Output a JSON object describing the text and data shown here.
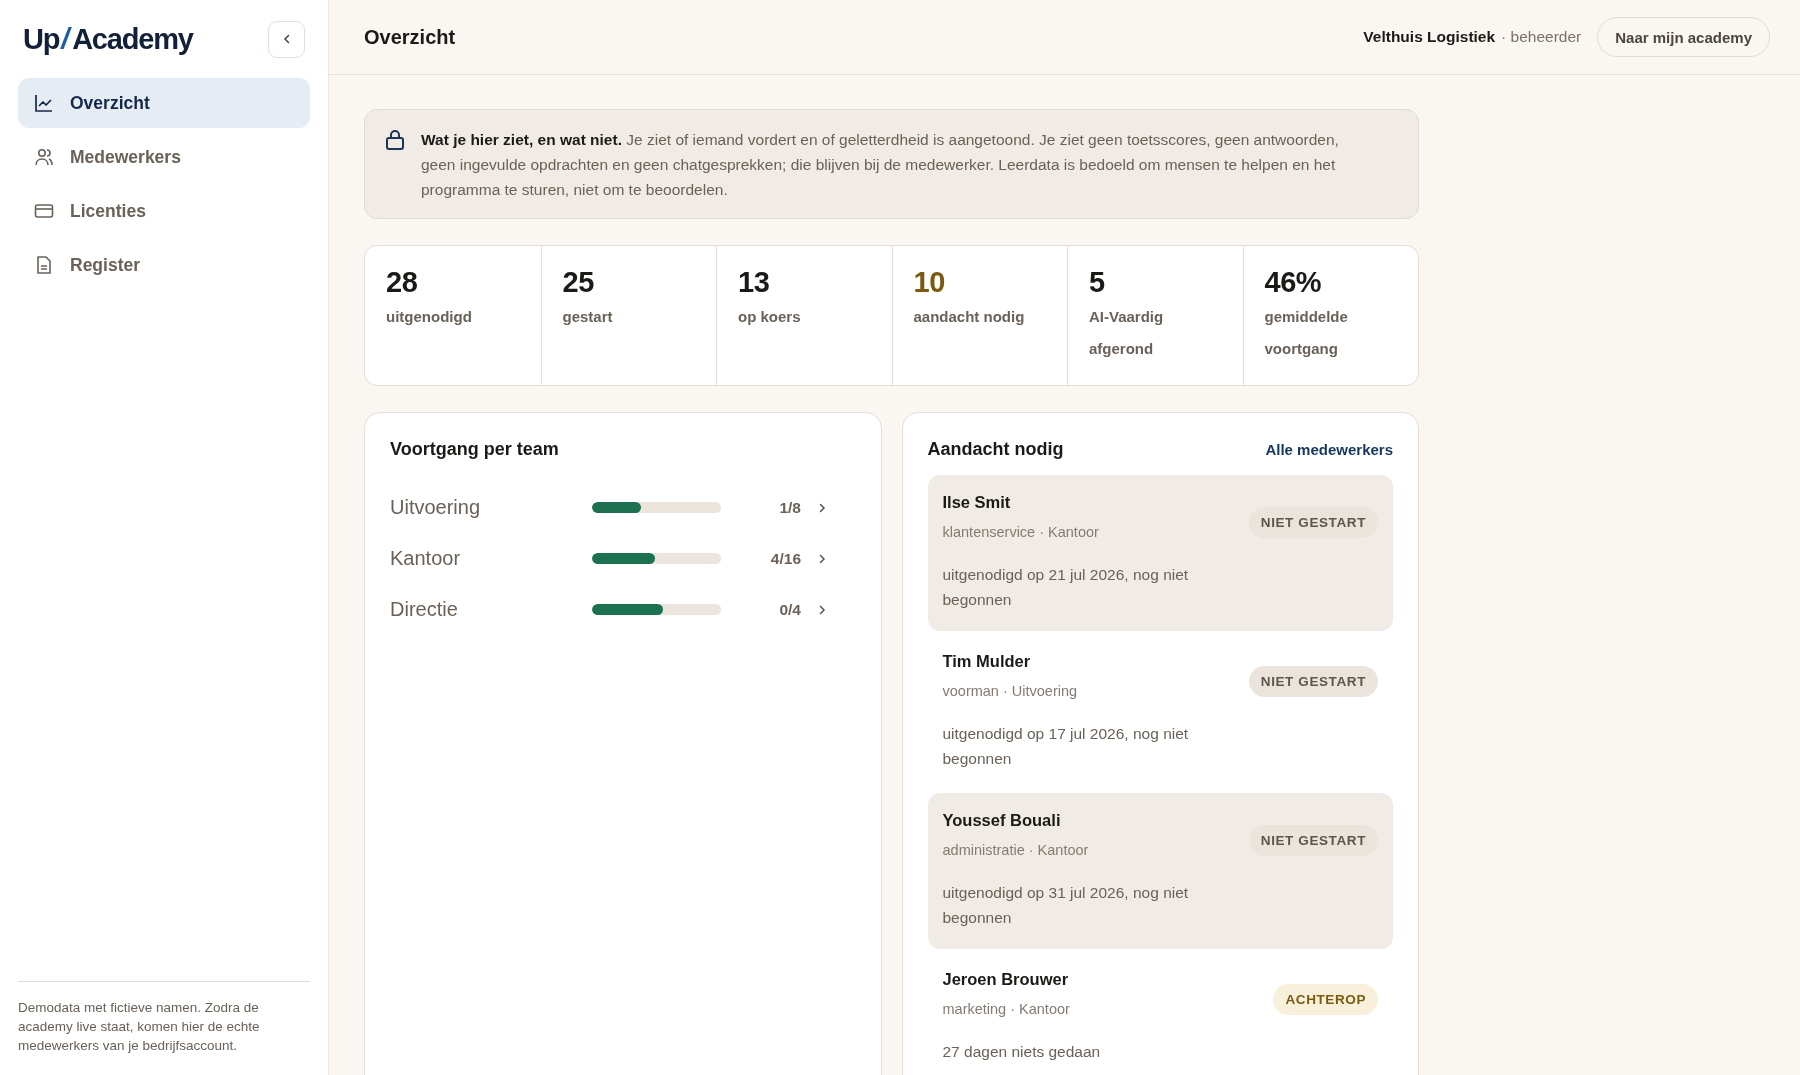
{
  "logo": {
    "first": "Up",
    "slash": "/",
    "second": "Academy"
  },
  "sidebar": {
    "items": [
      {
        "label": "Overzicht",
        "kind": "chart",
        "selected": true
      },
      {
        "label": "Medewerkers",
        "kind": "users",
        "selected": false
      },
      {
        "label": "Licenties",
        "kind": "card",
        "selected": false
      },
      {
        "label": "Register",
        "kind": "document",
        "selected": false
      }
    ],
    "footer": "Demodata met fictieve namen. Zodra de academy live staat, komen hier de echte medewerkers van je bedrijfsaccount."
  },
  "header": {
    "title": "Overzicht",
    "company": "Velthuis Logistiek",
    "role": "· beheerder",
    "button": "Naar mijn academy"
  },
  "notice": {
    "lead": "**Wat je hier ziet, en wat niet.** Je ziet of iemand vordert en of geletterdheid is aangetoond. Je ziet geen toetsscores, geen antwoorden, geen ingevulde opdrachten en geen chatgesprekken; die blijven bij de medewerker. Leerdata is bedoeld om mensen te helpen en het programma te sturen, niet om te beoordelen."
  },
  "stats": [
    {
      "value": "28",
      "label": "uitgenodigd",
      "kind": "normal"
    },
    {
      "value": "25",
      "label": "gestart",
      "kind": "normal"
    },
    {
      "value": "13",
      "label": "op koers",
      "kind": "normal"
    },
    {
      "value": "10",
      "label": "aandacht nodig",
      "kind": "attention"
    },
    {
      "value": "5",
      "label": "AI-Vaardig afgerond",
      "kind": "normal"
    },
    {
      "value": "46%",
      "label": "gemiddelde voortgang",
      "kind": "normal"
    }
  ],
  "teams": {
    "title": "Voortgang per team",
    "rows": [
      {
        "name": "Uitvoering",
        "level": 0.38,
        "count": "1/8"
      },
      {
        "name": "Kantoor",
        "level": 0.49,
        "count": "4/16"
      },
      {
        "name": "Directie",
        "level": 0.55,
        "count": "0/4"
      }
    ]
  },
  "attention": {
    "title": "Aandacht nodig",
    "link": "Alle medewerkers",
    "people": [
      {
        "name": "Ilse Smit",
        "meta": "klantenservice · Kantoor",
        "note": "uitgenodigd op 21 jul 2026, nog niet begonnen",
        "badge": "NIET GESTART",
        "kind": "not-started",
        "highlighted": true
      },
      {
        "name": "Tim Mulder",
        "meta": "voorman · Uitvoering",
        "note": "uitgenodigd op 17 jul 2026, nog niet begonnen",
        "badge": "NIET GESTART",
        "kind": "not-started",
        "highlighted": false
      },
      {
        "name": "Youssef Bouali",
        "meta": "administratie · Kantoor",
        "note": "uitgenodigd op 31 jul 2026, nog niet begonnen",
        "badge": "NIET GESTART",
        "kind": "not-started",
        "highlighted": true
      },
      {
        "name": "Jeroen Brouwer",
        "meta": "marketing · Kantoor",
        "note": "27 dagen niets gedaan",
        "badge": "ACHTEROP",
        "kind": "behind",
        "highlighted": false
      }
    ]
  }
}
